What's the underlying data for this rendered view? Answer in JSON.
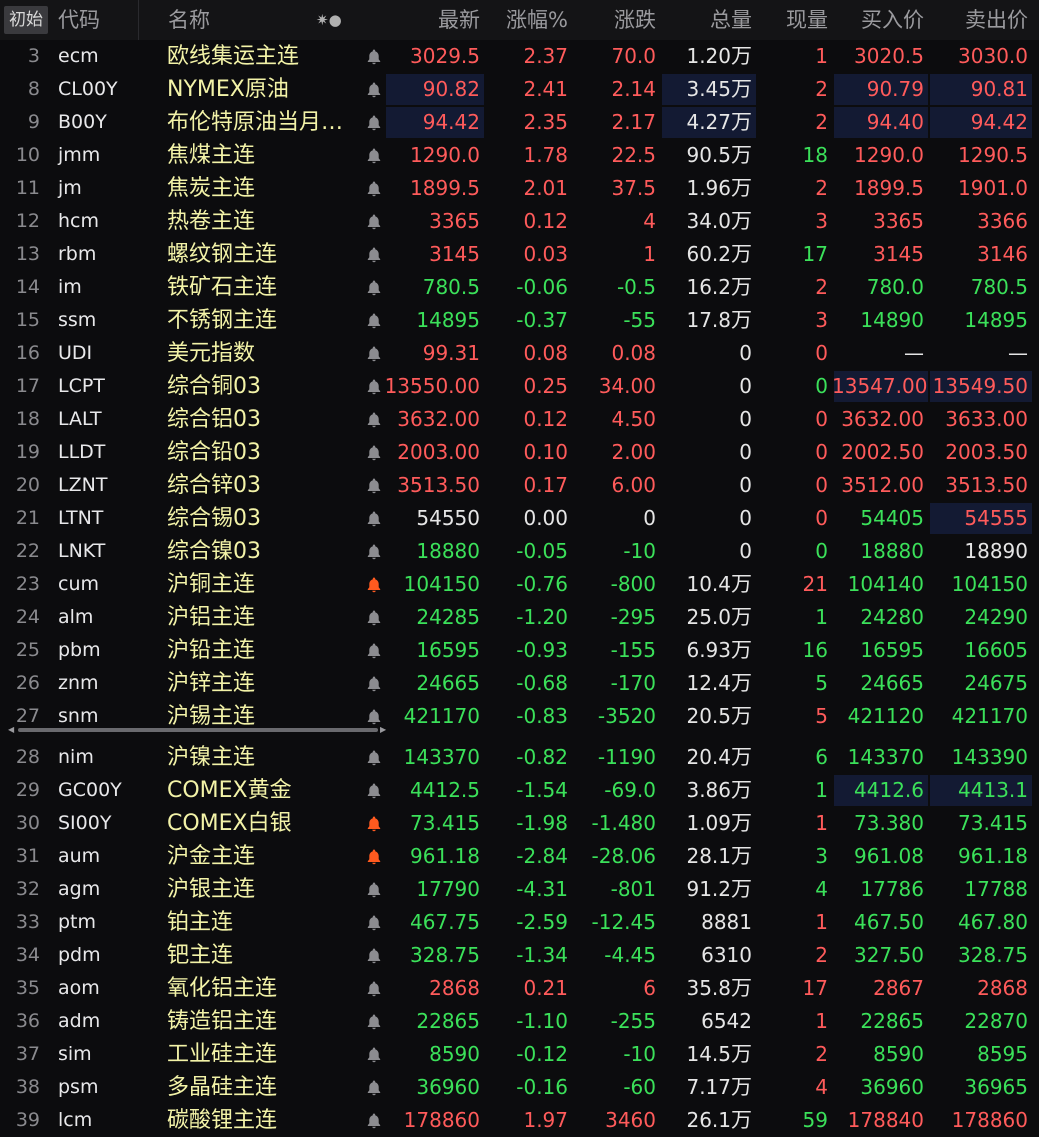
{
  "header": {
    "start_label": "初始",
    "code": "代码",
    "name": "名称",
    "sort_icons": "✷●",
    "last": "最新",
    "pct": "涨幅%",
    "chg": "涨跌",
    "volume": "总量",
    "now": "现量",
    "bid": "买入价",
    "ask": "卖出价"
  },
  "colors": {
    "up": "#ff5b5b",
    "down": "#3be15a",
    "flat": "#e6e6e6",
    "name": "#f3f3a8",
    "alert": "#ff5a1f",
    "bell": "#8c8c90",
    "highlight": "#131a33"
  },
  "rows": [
    {
      "idx": "3",
      "code": "ecm",
      "name": "欧线集运主连",
      "bell": "gray",
      "last": "3029.5",
      "pct": "2.37",
      "chg": "70.0",
      "vol": "1.20",
      "unit": "万",
      "now": "1",
      "bid": "3020.5",
      "ask": "3030.0",
      "c": {
        "last": "red",
        "pct": "red",
        "chg": "red",
        "now": "red",
        "bid": "red",
        "ask": "red"
      }
    },
    {
      "idx": "8",
      "code": "CL00Y",
      "name": "NYMEX原油",
      "bell": "gray",
      "last": "90.82",
      "pct": "2.41",
      "chg": "2.14",
      "vol": "3.45",
      "unit": "万",
      "now": "2",
      "bid": "90.79",
      "ask": "90.81",
      "c": {
        "last": "red",
        "pct": "red",
        "chg": "red",
        "now": "red",
        "bid": "red",
        "ask": "red"
      },
      "hl": [
        "last",
        "vol",
        "bid",
        "ask"
      ]
    },
    {
      "idx": "9",
      "code": "B00Y",
      "name": "布伦特原油当月…",
      "bell": "gray",
      "last": "94.42",
      "pct": "2.35",
      "chg": "2.17",
      "vol": "4.27",
      "unit": "万",
      "now": "2",
      "bid": "94.40",
      "ask": "94.42",
      "c": {
        "last": "red",
        "pct": "red",
        "chg": "red",
        "now": "red",
        "bid": "red",
        "ask": "red"
      },
      "hl": [
        "last",
        "vol",
        "bid",
        "ask"
      ]
    },
    {
      "idx": "10",
      "code": "jmm",
      "name": "焦煤主连",
      "bell": "gray",
      "last": "1290.0",
      "pct": "1.78",
      "chg": "22.5",
      "vol": "90.5",
      "unit": "万",
      "now": "18",
      "bid": "1290.0",
      "ask": "1290.5",
      "c": {
        "last": "red",
        "pct": "red",
        "chg": "red",
        "now": "green",
        "bid": "red",
        "ask": "red"
      }
    },
    {
      "idx": "11",
      "code": "jm",
      "name": "焦炭主连",
      "bell": "gray",
      "last": "1899.5",
      "pct": "2.01",
      "chg": "37.5",
      "vol": "1.96",
      "unit": "万",
      "now": "2",
      "bid": "1899.5",
      "ask": "1901.0",
      "c": {
        "last": "red",
        "pct": "red",
        "chg": "red",
        "now": "red",
        "bid": "red",
        "ask": "red"
      }
    },
    {
      "idx": "12",
      "code": "hcm",
      "name": "热卷主连",
      "bell": "gray",
      "last": "3365",
      "pct": "0.12",
      "chg": "4",
      "vol": "34.0",
      "unit": "万",
      "now": "3",
      "bid": "3365",
      "ask": "3366",
      "c": {
        "last": "red",
        "pct": "red",
        "chg": "red",
        "now": "red",
        "bid": "red",
        "ask": "red"
      }
    },
    {
      "idx": "13",
      "code": "rbm",
      "name": "螺纹钢主连",
      "bell": "gray",
      "last": "3145",
      "pct": "0.03",
      "chg": "1",
      "vol": "60.2",
      "unit": "万",
      "now": "17",
      "bid": "3145",
      "ask": "3146",
      "c": {
        "last": "red",
        "pct": "red",
        "chg": "red",
        "now": "green",
        "bid": "red",
        "ask": "red"
      }
    },
    {
      "idx": "14",
      "code": "im",
      "name": "铁矿石主连",
      "bell": "gray",
      "last": "780.5",
      "pct": "-0.06",
      "chg": "-0.5",
      "vol": "16.2",
      "unit": "万",
      "now": "2",
      "bid": "780.0",
      "ask": "780.5",
      "c": {
        "last": "green",
        "pct": "green",
        "chg": "green",
        "now": "red",
        "bid": "green",
        "ask": "green"
      }
    },
    {
      "idx": "15",
      "code": "ssm",
      "name": "不锈钢主连",
      "bell": "gray",
      "last": "14895",
      "pct": "-0.37",
      "chg": "-55",
      "vol": "17.8",
      "unit": "万",
      "now": "3",
      "bid": "14890",
      "ask": "14895",
      "c": {
        "last": "green",
        "pct": "green",
        "chg": "green",
        "now": "red",
        "bid": "green",
        "ask": "green"
      }
    },
    {
      "idx": "16",
      "code": "UDI",
      "name": "美元指数",
      "bell": "gray",
      "last": "99.31",
      "pct": "0.08",
      "chg": "0.08",
      "vol": "0",
      "unit": "",
      "now": "0",
      "bid": "—",
      "ask": "—",
      "c": {
        "last": "red",
        "pct": "red",
        "chg": "red",
        "now": "red",
        "bid": "white",
        "ask": "white"
      }
    },
    {
      "idx": "17",
      "code": "LCPT",
      "name": "综合铜03",
      "bell": "gray",
      "last": "13550.00",
      "pct": "0.25",
      "chg": "34.00",
      "vol": "0",
      "unit": "",
      "now": "0",
      "bid": "13547.00",
      "ask": "13549.50",
      "c": {
        "last": "red",
        "pct": "red",
        "chg": "red",
        "now": "green",
        "bid": "red",
        "ask": "red"
      },
      "hl": [
        "bid",
        "ask"
      ]
    },
    {
      "idx": "18",
      "code": "LALT",
      "name": "综合铝03",
      "bell": "gray",
      "last": "3632.00",
      "pct": "0.12",
      "chg": "4.50",
      "vol": "0",
      "unit": "",
      "now": "0",
      "bid": "3632.00",
      "ask": "3633.00",
      "c": {
        "last": "red",
        "pct": "red",
        "chg": "red",
        "now": "red",
        "bid": "red",
        "ask": "red"
      }
    },
    {
      "idx": "19",
      "code": "LLDT",
      "name": "综合铅03",
      "bell": "gray",
      "last": "2003.00",
      "pct": "0.10",
      "chg": "2.00",
      "vol": "0",
      "unit": "",
      "now": "0",
      "bid": "2002.50",
      "ask": "2003.50",
      "c": {
        "last": "red",
        "pct": "red",
        "chg": "red",
        "now": "red",
        "bid": "red",
        "ask": "red"
      }
    },
    {
      "idx": "20",
      "code": "LZNT",
      "name": "综合锌03",
      "bell": "gray",
      "last": "3513.50",
      "pct": "0.17",
      "chg": "6.00",
      "vol": "0",
      "unit": "",
      "now": "0",
      "bid": "3512.00",
      "ask": "3513.50",
      "c": {
        "last": "red",
        "pct": "red",
        "chg": "red",
        "now": "red",
        "bid": "red",
        "ask": "red"
      }
    },
    {
      "idx": "21",
      "code": "LTNT",
      "name": "综合锡03",
      "bell": "gray",
      "last": "54550",
      "pct": "0.00",
      "chg": "0",
      "vol": "0",
      "unit": "",
      "now": "0",
      "bid": "54405",
      "ask": "54555",
      "c": {
        "last": "white",
        "pct": "white",
        "chg": "white",
        "now": "red",
        "bid": "green",
        "ask": "red"
      },
      "hl": [
        "ask"
      ]
    },
    {
      "idx": "22",
      "code": "LNKT",
      "name": "综合镍03",
      "bell": "gray",
      "last": "18880",
      "pct": "-0.05",
      "chg": "-10",
      "vol": "0",
      "unit": "",
      "now": "0",
      "bid": "18880",
      "ask": "18890",
      "c": {
        "last": "green",
        "pct": "green",
        "chg": "green",
        "now": "green",
        "bid": "green",
        "ask": "white"
      }
    },
    {
      "idx": "23",
      "code": "cum",
      "name": "沪铜主连",
      "bell": "orange",
      "last": "104150",
      "pct": "-0.76",
      "chg": "-800",
      "vol": "10.4",
      "unit": "万",
      "now": "21",
      "bid": "104140",
      "ask": "104150",
      "c": {
        "last": "green",
        "pct": "green",
        "chg": "green",
        "now": "red",
        "bid": "green",
        "ask": "green"
      }
    },
    {
      "idx": "24",
      "code": "alm",
      "name": "沪铝主连",
      "bell": "gray",
      "last": "24285",
      "pct": "-1.20",
      "chg": "-295",
      "vol": "25.0",
      "unit": "万",
      "now": "1",
      "bid": "24280",
      "ask": "24290",
      "c": {
        "last": "green",
        "pct": "green",
        "chg": "green",
        "now": "green",
        "bid": "green",
        "ask": "green"
      }
    },
    {
      "idx": "25",
      "code": "pbm",
      "name": "沪铅主连",
      "bell": "gray",
      "last": "16595",
      "pct": "-0.93",
      "chg": "-155",
      "vol": "6.93",
      "unit": "万",
      "now": "16",
      "bid": "16595",
      "ask": "16605",
      "c": {
        "last": "green",
        "pct": "green",
        "chg": "green",
        "now": "green",
        "bid": "green",
        "ask": "green"
      }
    },
    {
      "idx": "26",
      "code": "znm",
      "name": "沪锌主连",
      "bell": "gray",
      "last": "24665",
      "pct": "-0.68",
      "chg": "-170",
      "vol": "12.4",
      "unit": "万",
      "now": "5",
      "bid": "24665",
      "ask": "24675",
      "c": {
        "last": "green",
        "pct": "green",
        "chg": "green",
        "now": "green",
        "bid": "green",
        "ask": "green"
      }
    },
    {
      "idx": "27",
      "code": "snm",
      "name": "沪锡主连",
      "bell": "gray",
      "last": "421170",
      "pct": "-0.83",
      "chg": "-3520",
      "vol": "20.5",
      "unit": "万",
      "now": "5",
      "bid": "421120",
      "ask": "421170",
      "c": {
        "last": "green",
        "pct": "green",
        "chg": "green",
        "now": "red",
        "bid": "green",
        "ask": "green"
      }
    },
    {
      "idx": "28",
      "code": "nim",
      "name": "沪镍主连",
      "bell": "gray",
      "last": "143370",
      "pct": "-0.82",
      "chg": "-1190",
      "vol": "20.4",
      "unit": "万",
      "now": "6",
      "bid": "143370",
      "ask": "143390",
      "c": {
        "last": "green",
        "pct": "green",
        "chg": "green",
        "now": "green",
        "bid": "green",
        "ask": "green"
      }
    },
    {
      "idx": "29",
      "code": "GC00Y",
      "name": "COMEX黄金",
      "bell": "gray",
      "last": "4412.5",
      "pct": "-1.54",
      "chg": "-69.0",
      "vol": "3.86",
      "unit": "万",
      "now": "1",
      "bid": "4412.6",
      "ask": "4413.1",
      "c": {
        "last": "green",
        "pct": "green",
        "chg": "green",
        "now": "green",
        "bid": "green",
        "ask": "green"
      },
      "hl": [
        "bid",
        "ask"
      ]
    },
    {
      "idx": "30",
      "code": "SI00Y",
      "name": "COMEX白银",
      "bell": "orange",
      "last": "73.415",
      "pct": "-1.98",
      "chg": "-1.480",
      "vol": "1.09",
      "unit": "万",
      "now": "1",
      "bid": "73.380",
      "ask": "73.415",
      "c": {
        "last": "green",
        "pct": "green",
        "chg": "green",
        "now": "red",
        "bid": "green",
        "ask": "green"
      }
    },
    {
      "idx": "31",
      "code": "aum",
      "name": "沪金主连",
      "bell": "orange",
      "last": "961.18",
      "pct": "-2.84",
      "chg": "-28.06",
      "vol": "28.1",
      "unit": "万",
      "now": "3",
      "bid": "961.08",
      "ask": "961.18",
      "c": {
        "last": "green",
        "pct": "green",
        "chg": "green",
        "now": "green",
        "bid": "green",
        "ask": "green"
      }
    },
    {
      "idx": "32",
      "code": "agm",
      "name": "沪银主连",
      "bell": "gray",
      "last": "17790",
      "pct": "-4.31",
      "chg": "-801",
      "vol": "91.2",
      "unit": "万",
      "now": "4",
      "bid": "17786",
      "ask": "17788",
      "c": {
        "last": "green",
        "pct": "green",
        "chg": "green",
        "now": "green",
        "bid": "green",
        "ask": "green"
      }
    },
    {
      "idx": "33",
      "code": "ptm",
      "name": "铂主连",
      "bell": "gray",
      "last": "467.75",
      "pct": "-2.59",
      "chg": "-12.45",
      "vol": "8881",
      "unit": "",
      "now": "1",
      "bid": "467.50",
      "ask": "467.80",
      "c": {
        "last": "green",
        "pct": "green",
        "chg": "green",
        "now": "red",
        "bid": "green",
        "ask": "green"
      }
    },
    {
      "idx": "34",
      "code": "pdm",
      "name": "钯主连",
      "bell": "gray",
      "last": "328.75",
      "pct": "-1.34",
      "chg": "-4.45",
      "vol": "6310",
      "unit": "",
      "now": "2",
      "bid": "327.50",
      "ask": "328.75",
      "c": {
        "last": "green",
        "pct": "green",
        "chg": "green",
        "now": "red",
        "bid": "green",
        "ask": "green"
      }
    },
    {
      "idx": "35",
      "code": "aom",
      "name": "氧化铝主连",
      "bell": "gray",
      "last": "2868",
      "pct": "0.21",
      "chg": "6",
      "vol": "35.8",
      "unit": "万",
      "now": "17",
      "bid": "2867",
      "ask": "2868",
      "c": {
        "last": "red",
        "pct": "red",
        "chg": "red",
        "now": "red",
        "bid": "red",
        "ask": "red"
      }
    },
    {
      "idx": "36",
      "code": "adm",
      "name": "铸造铝主连",
      "bell": "gray",
      "last": "22865",
      "pct": "-1.10",
      "chg": "-255",
      "vol": "6542",
      "unit": "",
      "now": "1",
      "bid": "22865",
      "ask": "22870",
      "c": {
        "last": "green",
        "pct": "green",
        "chg": "green",
        "now": "red",
        "bid": "green",
        "ask": "green"
      }
    },
    {
      "idx": "37",
      "code": "sim",
      "name": "工业硅主连",
      "bell": "gray",
      "last": "8590",
      "pct": "-0.12",
      "chg": "-10",
      "vol": "14.5",
      "unit": "万",
      "now": "2",
      "bid": "8590",
      "ask": "8595",
      "c": {
        "last": "green",
        "pct": "green",
        "chg": "green",
        "now": "red",
        "bid": "green",
        "ask": "green"
      }
    },
    {
      "idx": "38",
      "code": "psm",
      "name": "多晶硅主连",
      "bell": "gray",
      "last": "36960",
      "pct": "-0.16",
      "chg": "-60",
      "vol": "7.17",
      "unit": "万",
      "now": "4",
      "bid": "36960",
      "ask": "36965",
      "c": {
        "last": "green",
        "pct": "green",
        "chg": "green",
        "now": "red",
        "bid": "green",
        "ask": "green"
      }
    },
    {
      "idx": "39",
      "code": "lcm",
      "name": "碳酸锂主连",
      "bell": "gray",
      "last": "178860",
      "pct": "1.97",
      "chg": "3460",
      "vol": "26.1",
      "unit": "万",
      "now": "59",
      "bid": "178840",
      "ask": "178860",
      "c": {
        "last": "red",
        "pct": "red",
        "chg": "red",
        "now": "green",
        "bid": "red",
        "ask": "red"
      }
    }
  ]
}
